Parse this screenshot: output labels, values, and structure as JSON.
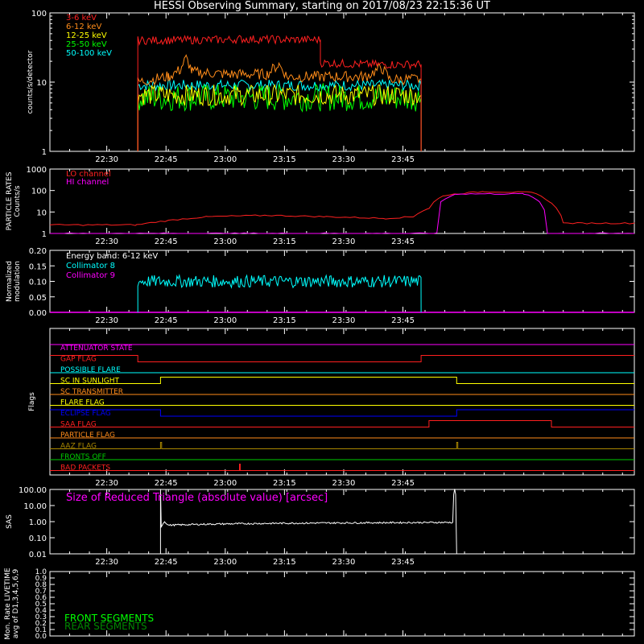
{
  "title": "HESSI Observing Summary, starting on 2017/08/23 22:15:36 UT",
  "time_ticks": [
    "22:30",
    "22:45",
    "23:00",
    "23:15",
    "23:30",
    "23:45"
  ],
  "chart_data": [
    {
      "type": "line",
      "panel": "counts",
      "ylabel": "counts/s/detector",
      "yscale": "log",
      "ylim": [
        1,
        100
      ],
      "yticks": [
        "1",
        "10",
        "100"
      ],
      "xlim_minutes": [
        22.27,
        50
      ],
      "x_unit": "minutes after 22:15:36 UT",
      "series": [
        {
          "name": "3-6 keV",
          "color": "#ff2020",
          "points": [
            [
              22.27,
              1
            ],
            [
              22.27,
              40
            ],
            [
              45,
              41
            ],
            [
              48,
              42
            ],
            [
              60,
              41
            ],
            [
              68.5,
              41
            ],
            [
              68.5,
              19
            ],
            [
              80,
              18
            ],
            [
              94,
              18
            ]
          ],
          "noise": 0.06
        },
        {
          "name": "6-12 keV",
          "color": "#ff8c1a",
          "points": [
            [
              22.27,
              1
            ],
            [
              22.27,
              10
            ],
            [
              30,
              12
            ],
            [
              33,
              15
            ],
            [
              34.5,
              22
            ],
            [
              36,
              14
            ],
            [
              45,
              13
            ],
            [
              55,
              13
            ],
            [
              58,
              18
            ],
            [
              60,
              12
            ],
            [
              68,
              12
            ],
            [
              80,
              12
            ],
            [
              84,
              16
            ],
            [
              86,
              11
            ],
            [
              94,
              11
            ]
          ],
          "noise": 0.08
        },
        {
          "name": "12-25 keV",
          "color": "#ffff00",
          "points": [
            [
              22.27,
              1
            ],
            [
              22.27,
              6.5
            ],
            [
              94,
              6.5
            ]
          ],
          "noise": 0.15
        },
        {
          "name": "25-50 keV",
          "color": "#00ff00",
          "points": [
            [
              22.27,
              1
            ],
            [
              22.27,
              6
            ],
            [
              94,
              6
            ]
          ],
          "noise": 0.2
        },
        {
          "name": "50-100 keV",
          "color": "#00ffff",
          "points": [
            [
              22.27,
              1
            ],
            [
              22.27,
              9
            ],
            [
              94,
              9
            ]
          ],
          "noise": 0.08
        }
      ],
      "x_end_minutes": 94
    },
    {
      "type": "line",
      "panel": "particle",
      "ylabel": "PARTICLE RATES Counts/s",
      "yscale": "log",
      "ylim": [
        1,
        1000
      ],
      "yticks": [
        "1",
        "10",
        "100",
        "1000"
      ],
      "series": [
        {
          "name": "LO channel",
          "color": "#ff2020",
          "points": [
            [
              0,
              2.5
            ],
            [
              22,
              2.5
            ],
            [
              30,
              4
            ],
            [
              40,
              6
            ],
            [
              55,
              7
            ],
            [
              70,
              6
            ],
            [
              85,
              5
            ],
            [
              92,
              6
            ],
            [
              96,
              15
            ],
            [
              100,
              60
            ],
            [
              110,
              90
            ],
            [
              122,
              80
            ],
            [
              127,
              25
            ],
            [
              130,
              3
            ],
            [
              148,
              3
            ]
          ]
        },
        {
          "name": "HI channel",
          "color": "#ff00ff",
          "points": [
            [
              0,
              1
            ],
            [
              98,
              1
            ],
            [
              99,
              30
            ],
            [
              103,
              70
            ],
            [
              120,
              70
            ],
            [
              124,
              30
            ],
            [
              126,
              1
            ],
            [
              148,
              1
            ]
          ]
        }
      ]
    },
    {
      "type": "line",
      "panel": "modulation",
      "ylabel": "Normalized modulation",
      "ylim": [
        0,
        0.2
      ],
      "yticks": [
        "0.00",
        "0.05",
        "0.10",
        "0.15",
        "0.20"
      ],
      "annotation": "Energy band: 6-12 keV",
      "series": [
        {
          "name": "Collimator 8",
          "color": "#00ffff",
          "points": [
            [
              22.27,
              0
            ],
            [
              22.27,
              0.1
            ],
            [
              94,
              0.1
            ],
            [
              94,
              0
            ]
          ],
          "noise": 0.02
        },
        {
          "name": "Collimator 9",
          "color": "#ff00ff",
          "points": [
            [
              0,
              0
            ],
            [
              148,
              0
            ]
          ]
        }
      ]
    },
    {
      "type": "line",
      "panel": "flags",
      "ylabel": "Flags",
      "flags": [
        {
          "name": "ATTENUATOR STATE",
          "color": "#ff00ff",
          "segments": [
            [
              0,
              148,
              1
            ]
          ]
        },
        {
          "name": "GAP FLAG",
          "color": "#ff2020",
          "segments": [
            [
              0,
              22.27,
              1
            ],
            [
              22.27,
              94,
              0
            ],
            [
              94,
              148,
              1
            ]
          ]
        },
        {
          "name": "POSSIBLE FLARE",
          "color": "#00ffff",
          "segments": [
            [
              0,
              148,
              0
            ]
          ]
        },
        {
          "name": "SC IN SUNLIGHT",
          "color": "#ffff00",
          "segments": [
            [
              0,
              28,
              0
            ],
            [
              28,
              103,
              1
            ],
            [
              103,
              148,
              0
            ]
          ]
        },
        {
          "name": "SC TRANSMITTER",
          "color": "#ff8c1a",
          "segments": [
            [
              0,
              148,
              0
            ]
          ]
        },
        {
          "name": "FLARE FLAG",
          "color": "#ffff00",
          "segments": [
            [
              0,
              148,
              0
            ]
          ]
        },
        {
          "name": "ECLIPSE FLAG",
          "color": "#0000ff",
          "segments": [
            [
              0,
              28,
              1
            ],
            [
              28,
              103,
              0
            ],
            [
              103,
              148,
              1
            ]
          ]
        },
        {
          "name": "SAA FLAG",
          "color": "#ff2020",
          "segments": [
            [
              0,
              96,
              0
            ],
            [
              96,
              127,
              1
            ],
            [
              127,
              148,
              0
            ]
          ]
        },
        {
          "name": "PARTICLE FLAG",
          "color": "#ff8c1a",
          "segments": [
            [
              0,
              148,
              0
            ]
          ]
        },
        {
          "name": "AAZ FLAG",
          "color": "#aa8800",
          "segments": [
            [
              0,
              28,
              0
            ],
            [
              28,
              28.3,
              1
            ],
            [
              28.3,
              103,
              0
            ],
            [
              103,
              103.3,
              1
            ],
            [
              103.3,
              148,
              0
            ]
          ]
        },
        {
          "name": "FRONTS OFF",
          "color": "#00cc00",
          "segments": [
            [
              0,
              148,
              0
            ]
          ]
        },
        {
          "name": "BAD PACKETS",
          "color": "#ff2020",
          "segments": [
            [
              0,
              48,
              0
            ],
            [
              48,
              48.2,
              1
            ],
            [
              48.2,
              148,
              0
            ]
          ]
        }
      ]
    },
    {
      "type": "line",
      "panel": "sas",
      "ylabel": "SAS",
      "yscale": "log",
      "ylim": [
        0.01,
        100
      ],
      "yticks": [
        "0.01",
        "0.10",
        "1.00",
        "10.00",
        "100.00"
      ],
      "annotation": "Size of Reduced Triangle (absolute value) [arcsec]",
      "series": [
        {
          "name": "SAS",
          "color": "#ffffff",
          "points": [
            [
              28,
              0.01
            ],
            [
              28,
              100
            ],
            [
              28.2,
              0.5
            ],
            [
              29,
              1.0
            ],
            [
              30,
              0.6
            ],
            [
              40,
              0.7
            ],
            [
              60,
              0.8
            ],
            [
              80,
              0.85
            ],
            [
              102,
              0.9
            ],
            [
              102.5,
              100
            ],
            [
              103,
              0.01
            ]
          ],
          "noise": 0.05
        }
      ]
    },
    {
      "type": "line",
      "panel": "livetime",
      "ylabel": "Mon. Rate LIVETIME avg of D1,3,4,5,6,9",
      "ylim": [
        0,
        1
      ],
      "yticks": [
        "0.0",
        "0.1",
        "0.2",
        "0.3",
        "0.4",
        "0.5",
        "0.6",
        "0.7",
        "0.8",
        "0.9",
        "1.0"
      ],
      "series": [
        {
          "name": "FRONT SEGMENTS",
          "color": "#00ff00",
          "points": []
        },
        {
          "name": "REAR SEGMENTS",
          "color": "#008800",
          "points": []
        }
      ]
    }
  ]
}
